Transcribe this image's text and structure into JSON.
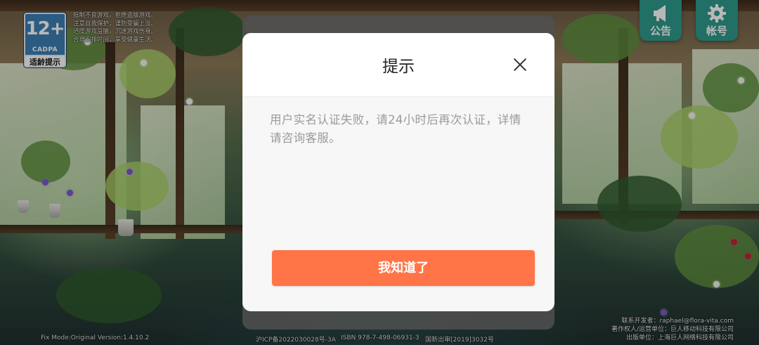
{
  "cadpa": {
    "age": "12+",
    "org": "CADPA",
    "label": "适龄提示"
  },
  "health_notice": [
    "抵制不良游戏，拒绝盗版游戏。",
    "注意自我保护，谨防受骗上当。",
    "适度游戏益脑，沉迷游戏伤身。",
    "合理安排时间，享受健康生活。"
  ],
  "top_buttons": {
    "announcement_label": "公告",
    "account_label": "帐号"
  },
  "dialog": {
    "title": "提示",
    "message": "用户实名认证失败，请24小时后再次认证，详情请咨询客服。",
    "confirm_label": "我知道了"
  },
  "footer": {
    "version": "Fix Mode:Original Version:1.4.10.2",
    "icp": "沪ICP备2022030028号-3A",
    "isbn": "ISBN 978-7-498-06931-3",
    "approval": "国新出审[2019]3032号",
    "credits": [
      "联系开发者：raphael@flora-vita.com",
      "著作权人/运营单位：巨人移动科技有限公司",
      "出版单位：上海巨人网络科技有限公司"
    ]
  }
}
